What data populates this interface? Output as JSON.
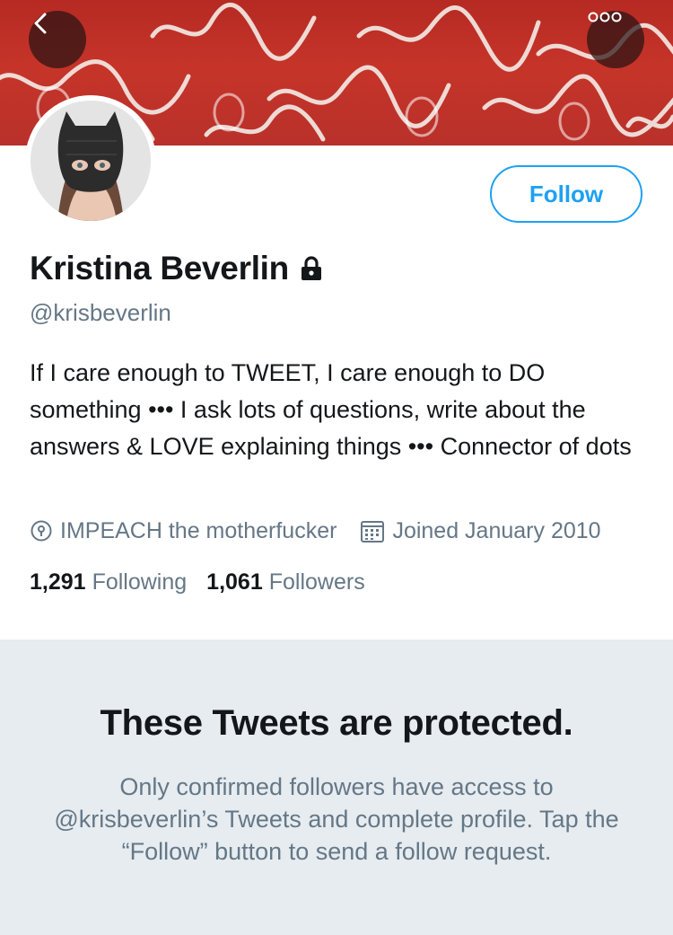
{
  "header": {
    "banner_words": [
      "love",
      "love",
      "love",
      "love"
    ]
  },
  "actions": {
    "follow_label": "Follow"
  },
  "profile": {
    "name": "Kristina Beverlin",
    "handle": "@krisbeverlin",
    "bio": "If I care enough to TWEET, I care enough to DO something ••• I ask lots of questions, write about the answers & LOVE explaining things ••• Connector of dots",
    "location": "IMPEACH the motherfucker",
    "joined": "Joined January 2010",
    "following_count": "1,291",
    "following_label": "Following",
    "followers_count": "1,061",
    "followers_label": "Followers"
  },
  "protected": {
    "title": "These Tweets are protected.",
    "message": "Only confirmed followers have access to @krisbeverlin’s Tweets and complete profile. Tap the “Follow” button to send a follow request."
  },
  "colors": {
    "accent": "#1da1f2",
    "secondary_text": "#657786",
    "banner_red": "#c63429",
    "protected_bg": "#e6ecf0"
  },
  "icons": [
    "back-arrow-icon",
    "more-icon",
    "lock-icon",
    "location-icon",
    "calendar-icon"
  ]
}
